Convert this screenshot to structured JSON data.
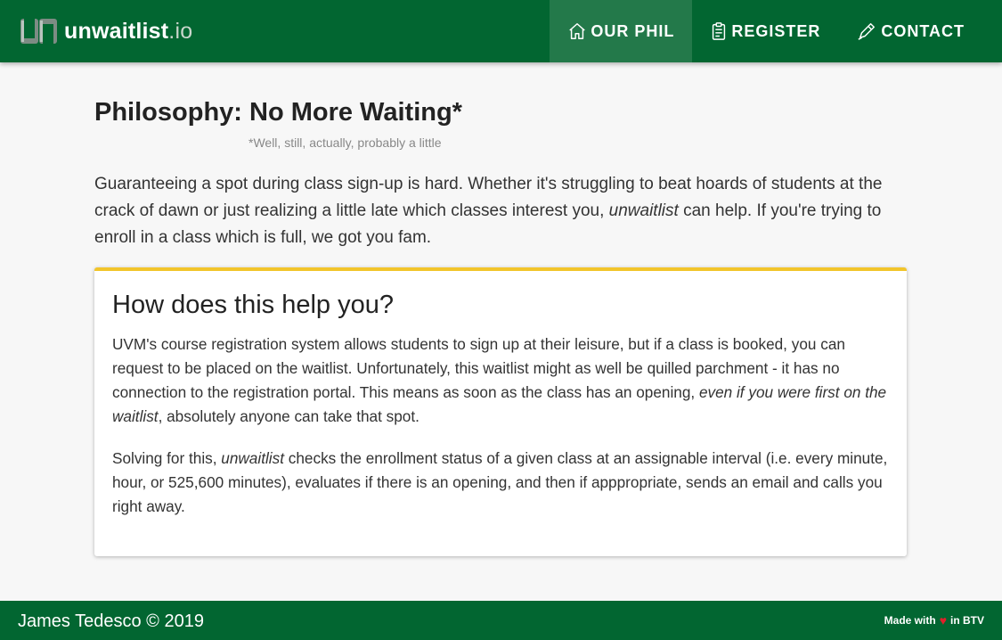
{
  "brand": {
    "name": "unwaitlist",
    "tld": ".io"
  },
  "nav": {
    "items": [
      {
        "label": "OUR PHIL",
        "icon": "home-icon",
        "active": true
      },
      {
        "label": "REGISTER",
        "icon": "clipboard-icon",
        "active": false
      },
      {
        "label": "CONTACT",
        "icon": "pen-icon",
        "active": false
      }
    ]
  },
  "main": {
    "title": "Philosophy: No More Waiting*",
    "title_note": "*Well, still, actually, probably a little",
    "intro": {
      "part1": "Guaranteeing a spot during class sign-up is hard. Whether it's struggling to beat hoards of students at the crack of dawn or just realizing a little late which classes interest you, ",
      "em": "unwaitlist",
      "part2": " can help. If you're trying to enroll in a class which is full, we got you fam."
    }
  },
  "card": {
    "title": "How does this help you?",
    "p1": {
      "part1": "UVM's course registration system allows students to sign up at their leisure, but if a class is booked, you can request to be placed on the waitlist. Unfortunately, this waitlist might as well be quilled parchment - it has no connection to the registration portal. This means as soon as the class has an opening, ",
      "em": "even if you were first on the waitlist",
      "part2": ", absolutely anyone can take that spot."
    },
    "p2": {
      "part1": "Solving for this, ",
      "em": "unwaitlist",
      "part2": " checks the enrollment status of a given class at an assignable interval (i.e. every minute, hour, or 525,600 minutes), evaluates if there is an opening, and then if apppropriate, sends an email and calls you right away."
    }
  },
  "footer": {
    "copyright": "James Tedesco © 2019",
    "made_with": "Made with",
    "location": "in BTV"
  },
  "colors": {
    "primary": "#026631",
    "active_nav": "#23794a",
    "accent": "#f2c52b",
    "heart": "#e0202a"
  }
}
